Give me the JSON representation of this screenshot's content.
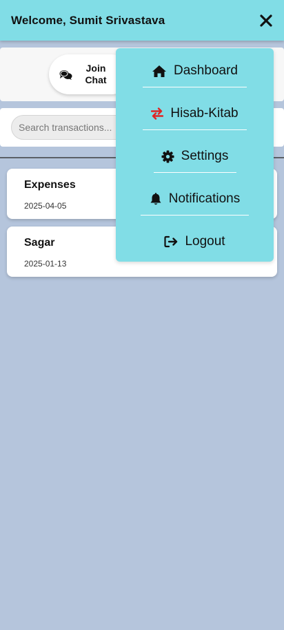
{
  "header": {
    "title": "Welcome, Sumit Srivastava"
  },
  "chat": {
    "join_label": "Join Chat"
  },
  "search": {
    "placeholder": "Search transactions..."
  },
  "transactions": [
    {
      "name": "Expenses",
      "date": "2025-04-05"
    },
    {
      "name": "Sagar",
      "date": "2025-01-13"
    }
  ],
  "menu": {
    "items": [
      {
        "label": "Dashboard",
        "icon": "home-icon"
      },
      {
        "label": "Hisab-Kitab",
        "icon": "exchange-icon"
      },
      {
        "label": "Settings",
        "icon": "gear-icon"
      },
      {
        "label": "Notifications",
        "icon": "bell-icon"
      },
      {
        "label": "Logout",
        "icon": "logout-icon"
      }
    ]
  },
  "colors": {
    "header_bg": "#81dde6",
    "page_bg": "#b5c5dc",
    "exchange_icon": "#e02424"
  }
}
